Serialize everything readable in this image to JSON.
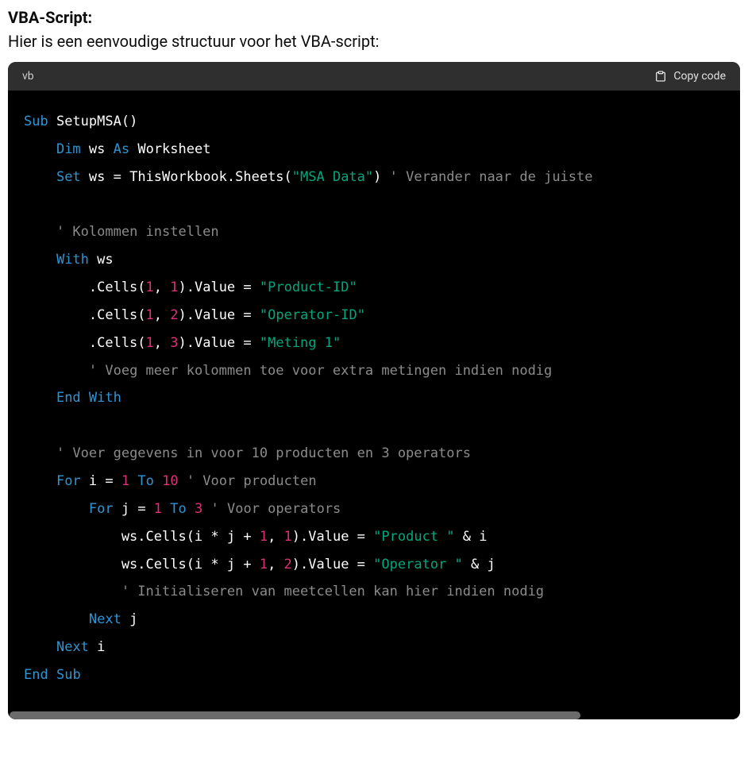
{
  "heading": "VBA-Script:",
  "subheading": "Hier is een eenvoudige structuur voor het VBA-script:",
  "code_header": {
    "lang": "vb",
    "copy_label": "Copy code"
  },
  "code": {
    "lines": [
      [
        {
          "c": "kw",
          "t": "Sub"
        },
        {
          "c": "plain",
          "t": " SetupMSA()"
        }
      ],
      [
        {
          "c": "plain",
          "t": "    "
        },
        {
          "c": "kw",
          "t": "Dim"
        },
        {
          "c": "plain",
          "t": " ws "
        },
        {
          "c": "kw",
          "t": "As"
        },
        {
          "c": "plain",
          "t": " Worksheet"
        }
      ],
      [
        {
          "c": "plain",
          "t": "    "
        },
        {
          "c": "kw",
          "t": "Set"
        },
        {
          "c": "plain",
          "t": " ws = ThisWorkbook.Sheets("
        },
        {
          "c": "str",
          "t": "\"MSA Data\""
        },
        {
          "c": "plain",
          "t": ") "
        },
        {
          "c": "com",
          "t": "' Verander naar de juiste "
        }
      ],
      [
        {
          "c": "plain",
          "t": "    "
        }
      ],
      [
        {
          "c": "plain",
          "t": "    "
        },
        {
          "c": "com",
          "t": "' Kolommen instellen"
        }
      ],
      [
        {
          "c": "plain",
          "t": "    "
        },
        {
          "c": "kw",
          "t": "With"
        },
        {
          "c": "plain",
          "t": " ws"
        }
      ],
      [
        {
          "c": "plain",
          "t": "        .Cells("
        },
        {
          "c": "num",
          "t": "1"
        },
        {
          "c": "plain",
          "t": ", "
        },
        {
          "c": "num",
          "t": "1"
        },
        {
          "c": "plain",
          "t": ").Value = "
        },
        {
          "c": "str",
          "t": "\"Product-ID\""
        }
      ],
      [
        {
          "c": "plain",
          "t": "        .Cells("
        },
        {
          "c": "num",
          "t": "1"
        },
        {
          "c": "plain",
          "t": ", "
        },
        {
          "c": "num",
          "t": "2"
        },
        {
          "c": "plain",
          "t": ").Value = "
        },
        {
          "c": "str",
          "t": "\"Operator-ID\""
        }
      ],
      [
        {
          "c": "plain",
          "t": "        .Cells("
        },
        {
          "c": "num",
          "t": "1"
        },
        {
          "c": "plain",
          "t": ", "
        },
        {
          "c": "num",
          "t": "3"
        },
        {
          "c": "plain",
          "t": ").Value = "
        },
        {
          "c": "str",
          "t": "\"Meting 1\""
        }
      ],
      [
        {
          "c": "plain",
          "t": "        "
        },
        {
          "c": "com",
          "t": "' Voeg meer kolommen toe voor extra metingen indien nodig"
        }
      ],
      [
        {
          "c": "plain",
          "t": "    "
        },
        {
          "c": "kw",
          "t": "End"
        },
        {
          "c": "plain",
          "t": " "
        },
        {
          "c": "kw",
          "t": "With"
        }
      ],
      [
        {
          "c": "plain",
          "t": "    "
        }
      ],
      [
        {
          "c": "plain",
          "t": "    "
        },
        {
          "c": "com",
          "t": "' Voer gegevens in voor 10 producten en 3 operators"
        }
      ],
      [
        {
          "c": "plain",
          "t": "    "
        },
        {
          "c": "kw",
          "t": "For"
        },
        {
          "c": "plain",
          "t": " i = "
        },
        {
          "c": "num",
          "t": "1"
        },
        {
          "c": "plain",
          "t": " "
        },
        {
          "c": "kw",
          "t": "To"
        },
        {
          "c": "plain",
          "t": " "
        },
        {
          "c": "num",
          "t": "10"
        },
        {
          "c": "plain",
          "t": " "
        },
        {
          "c": "com",
          "t": "' Voor producten"
        }
      ],
      [
        {
          "c": "plain",
          "t": "        "
        },
        {
          "c": "kw",
          "t": "For"
        },
        {
          "c": "plain",
          "t": " j = "
        },
        {
          "c": "num",
          "t": "1"
        },
        {
          "c": "plain",
          "t": " "
        },
        {
          "c": "kw",
          "t": "To"
        },
        {
          "c": "plain",
          "t": " "
        },
        {
          "c": "num",
          "t": "3"
        },
        {
          "c": "plain",
          "t": " "
        },
        {
          "c": "com",
          "t": "' Voor operators"
        }
      ],
      [
        {
          "c": "plain",
          "t": "            ws.Cells(i * j + "
        },
        {
          "c": "num",
          "t": "1"
        },
        {
          "c": "plain",
          "t": ", "
        },
        {
          "c": "num",
          "t": "1"
        },
        {
          "c": "plain",
          "t": ").Value = "
        },
        {
          "c": "str",
          "t": "\"Product \""
        },
        {
          "c": "plain",
          "t": " & i"
        }
      ],
      [
        {
          "c": "plain",
          "t": "            ws.Cells(i * j + "
        },
        {
          "c": "num",
          "t": "1"
        },
        {
          "c": "plain",
          "t": ", "
        },
        {
          "c": "num",
          "t": "2"
        },
        {
          "c": "plain",
          "t": ").Value = "
        },
        {
          "c": "str",
          "t": "\"Operator \""
        },
        {
          "c": "plain",
          "t": " & j"
        }
      ],
      [
        {
          "c": "plain",
          "t": "            "
        },
        {
          "c": "com",
          "t": "' Initialiseren van meetcellen kan hier indien nodig"
        }
      ],
      [
        {
          "c": "plain",
          "t": "        "
        },
        {
          "c": "kw",
          "t": "Next"
        },
        {
          "c": "plain",
          "t": " j"
        }
      ],
      [
        {
          "c": "plain",
          "t": "    "
        },
        {
          "c": "kw",
          "t": "Next"
        },
        {
          "c": "plain",
          "t": " i"
        }
      ],
      [
        {
          "c": "kw",
          "t": "End"
        },
        {
          "c": "plain",
          "t": " "
        },
        {
          "c": "kw",
          "t": "Sub"
        }
      ]
    ]
  }
}
